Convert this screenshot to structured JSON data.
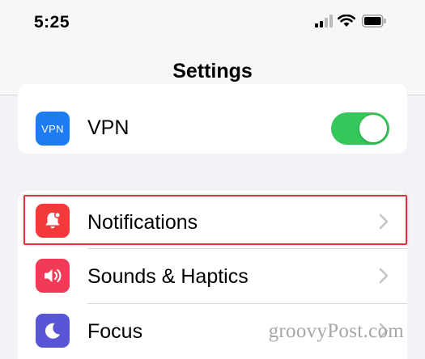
{
  "status_bar": {
    "time": "5:25",
    "icons": [
      "cellular-signal-icon",
      "wifi-icon",
      "battery-icon"
    ]
  },
  "nav": {
    "title": "Settings"
  },
  "vpn_group": {
    "items": [
      {
        "label": "VPN",
        "icon_text": "VPN",
        "icon": "vpn-icon",
        "icon_color": "#1e7cf2",
        "toggle_on": true
      }
    ]
  },
  "main_group": {
    "items": [
      {
        "label": "Notifications",
        "icon": "bell-icon",
        "icon_color": "#f33a3a",
        "highlighted": true
      },
      {
        "label": "Sounds & Haptics",
        "icon": "speaker-icon",
        "icon_color": "#f13a58"
      },
      {
        "label": "Focus",
        "icon": "moon-icon",
        "icon_color": "#5a54d6"
      }
    ]
  },
  "colors": {
    "toggle_on": "#34c759",
    "highlight_border": "#d9373e",
    "background": "#f2f2f7"
  },
  "watermark": "groovyPost.com"
}
